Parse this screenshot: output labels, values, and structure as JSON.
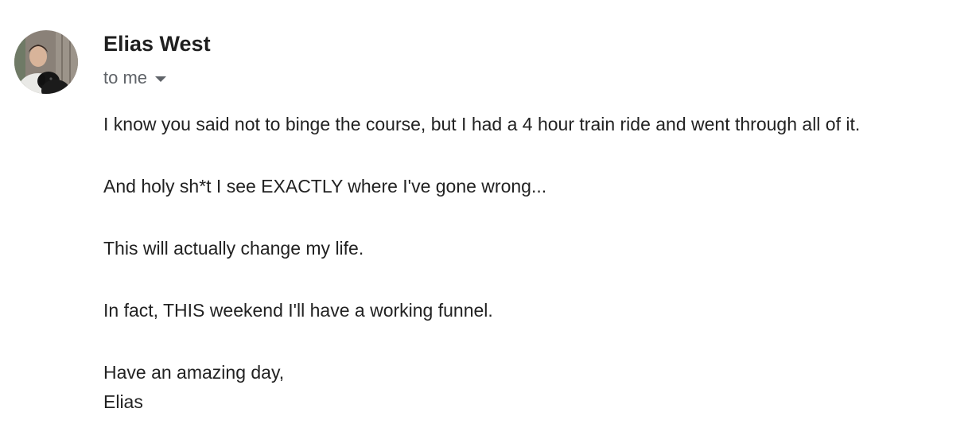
{
  "email": {
    "sender": {
      "name": "Elias West",
      "avatar_icon": "sender-avatar-photo"
    },
    "recipient": {
      "label": "to me",
      "toggle_icon": "chevron-down-icon"
    },
    "body": {
      "paragraphs": [
        "I know you said not to binge the course, but I had a 4 hour train ride and went through all of it.",
        "And holy sh*t I see EXACTLY where I've gone wrong...",
        "This will actually change my life.",
        "In fact, THIS weekend I'll have a working funnel."
      ],
      "signoff": "Have an amazing day,",
      "signature": "Elias"
    }
  },
  "colors": {
    "sender_name": "#1f1f1f",
    "secondary_text": "#5f6368",
    "body_text": "#222222"
  }
}
